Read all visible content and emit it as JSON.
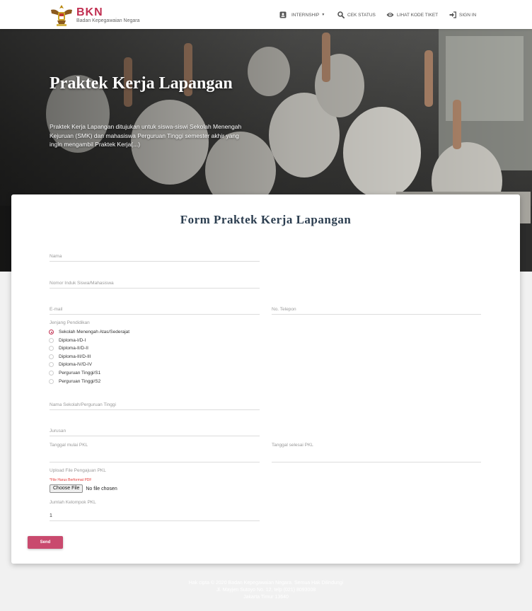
{
  "brand": {
    "name": "BKN",
    "subtitle": "Badan Kepegawaian Negara"
  },
  "nav": {
    "items": [
      {
        "label": "INTERNSHIP",
        "icon": "id-card-icon",
        "has_dropdown": true
      },
      {
        "label": "CEK STATUS",
        "icon": "search-icon"
      },
      {
        "label": "LIHAT KODE TIKET",
        "icon": "eye-icon"
      },
      {
        "label": "SIGN IN",
        "icon": "sign-in-icon"
      }
    ]
  },
  "hero": {
    "title": "Praktek Kerja Lapangan",
    "description": "Praktek Kerja Lapangan ditujukan untuk siswa-siswi Sekolah Menengah Kejuruan (SMK) dan mahasiswa Perguruan Tinggi semester akhir yang ingin mengambil Praktek Kerja(...)"
  },
  "form": {
    "title": "Form Praktek Kerja Lapangan",
    "fields": {
      "nama": "Nama",
      "nomor_induk": "Nomor Induk Siswa/Mahasiswa",
      "email": "E-mail",
      "telepon": "No. Telepon",
      "sekolah": "Nama Sekolah/Perguruan Tinggi",
      "jurusan": "Jurusan",
      "tanggal_mulai": "Tanggal mulai PKL",
      "tanggal_selesai": "Tanggal selesai PKL",
      "jumlah_label": "Jumlah Kelompok PKL",
      "jumlah_value": "1"
    },
    "jenjang": {
      "label": "Jenjang Pendidikan",
      "selected": 0,
      "options": [
        "Sekolah Menengah Atas/Sederajat",
        "Diploma-I/D-I",
        "Diploma-II/D-II",
        "Diploma-III/D-III",
        "Diploma-IV/D-IV",
        "Perguruan Tinggi/S1",
        "Perguruan Tinggi/S2"
      ]
    },
    "upload": {
      "label": "Upload File Pengajuan PKL",
      "note": "*File Harus Berformat PDF",
      "button": "Choose File",
      "status": "No file chosen"
    },
    "send_label": "Send"
  },
  "footer": {
    "line1": "Hak cipta © 2020 Badan Kepegawaian Negara. Semua Hak Dilindungi",
    "line2": "Jl. Mayjen Sutoyo No. 12, telp (021) 8093008",
    "line3": "Jakarta Timur 13640"
  },
  "colors": {
    "accent": "#c12e50",
    "button": "#c94a6e",
    "title": "#2c3e50"
  }
}
